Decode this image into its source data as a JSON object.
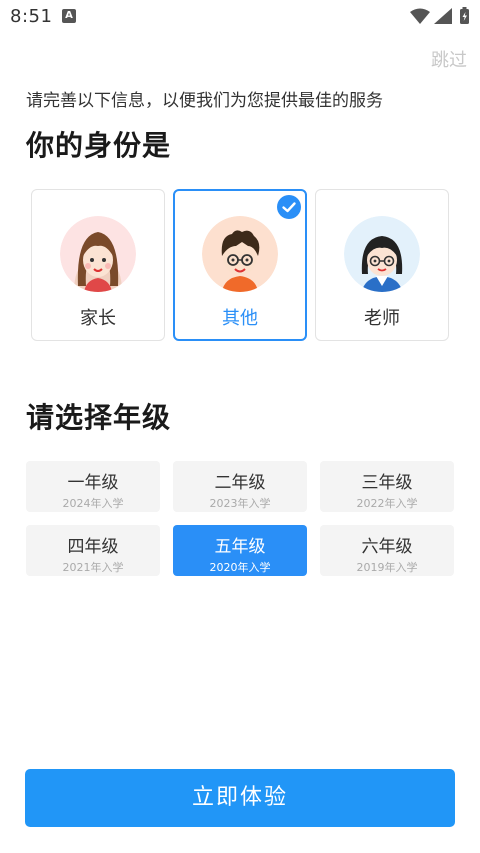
{
  "status_bar": {
    "time": "8:51",
    "notification_glyph": "A",
    "icons": [
      "wifi-icon",
      "signal-icon",
      "battery-charging-icon"
    ]
  },
  "skip_label": "跳过",
  "subtitle": "请完善以下信息，以便我们为您提供最佳的服务",
  "identity": {
    "heading": "你的身份是",
    "roles": [
      {
        "label": "家长",
        "avatar": "parent-avatar-icon",
        "selected": false
      },
      {
        "label": "其他",
        "avatar": "other-avatar-icon",
        "selected": true
      },
      {
        "label": "老师",
        "avatar": "teacher-avatar-icon",
        "selected": false
      }
    ]
  },
  "grade": {
    "heading": "请选择年级",
    "options": [
      {
        "name": "一年级",
        "year": "2024年入学",
        "selected": false
      },
      {
        "name": "二年级",
        "year": "2023年入学",
        "selected": false
      },
      {
        "name": "三年级",
        "year": "2022年入学",
        "selected": false
      },
      {
        "name": "四年级",
        "year": "2021年入学",
        "selected": false
      },
      {
        "name": "五年级",
        "year": "2020年入学",
        "selected": true
      },
      {
        "name": "六年级",
        "year": "2019年入学",
        "selected": false
      }
    ]
  },
  "cta_label": "立即体验",
  "colors": {
    "accent": "#2a8ff7",
    "cta": "#2196f7",
    "card_border": "#e3e3e3",
    "grade_bg": "#f4f4f4",
    "skip_text": "#c8c8c8"
  }
}
